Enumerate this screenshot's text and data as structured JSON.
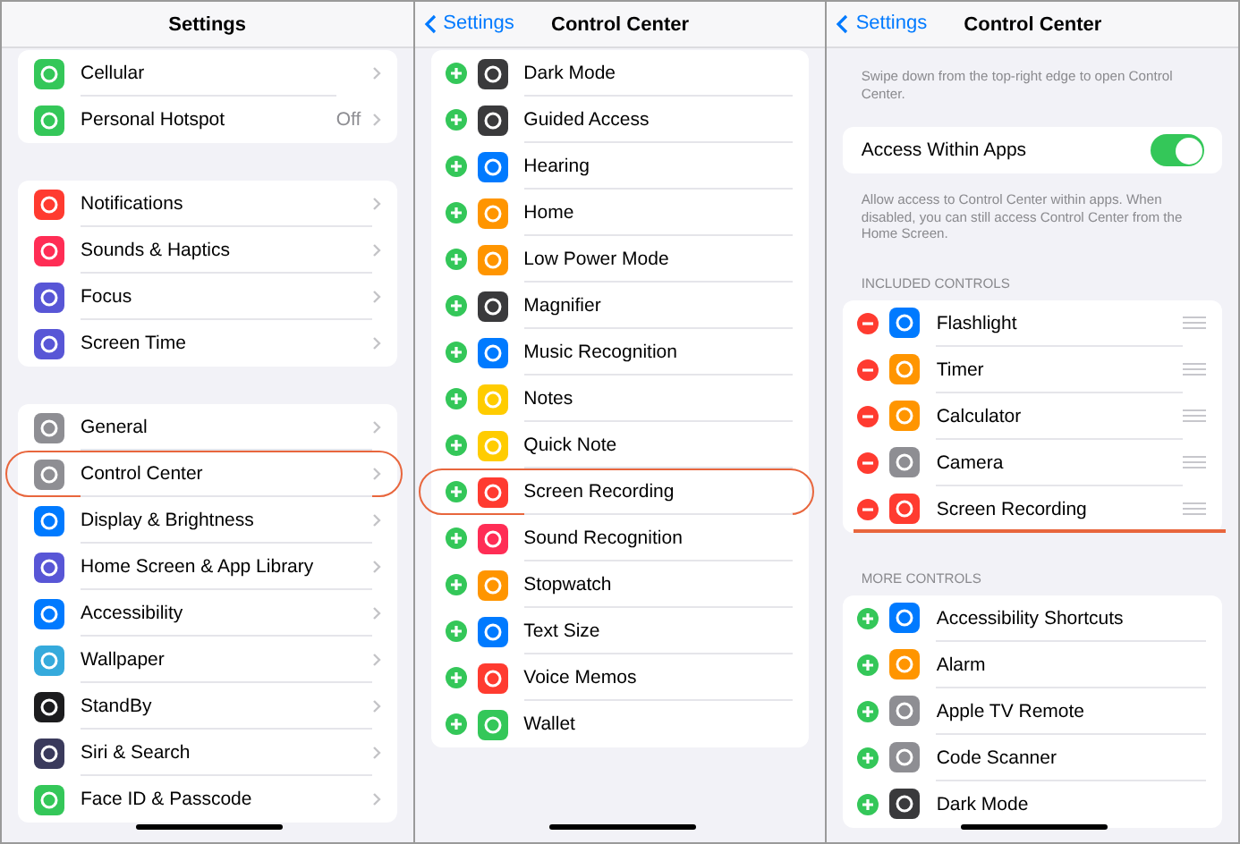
{
  "panels": [
    {
      "header": {
        "title": "Settings"
      },
      "sections": [
        {
          "kind": "group",
          "chevrons": true,
          "rows": [
            {
              "label": "Cellular",
              "color": "#34c759"
            },
            {
              "label": "Personal Hotspot",
              "value": "Off",
              "color": "#34c759"
            }
          ]
        },
        {
          "kind": "group",
          "chevrons": true,
          "rows": [
            {
              "label": "Notifications",
              "color": "#ff3b30"
            },
            {
              "label": "Sounds & Haptics",
              "color": "#ff2d55"
            },
            {
              "label": "Focus",
              "color": "#5856d6"
            },
            {
              "label": "Screen Time",
              "color": "#5856d6"
            }
          ]
        },
        {
          "kind": "group",
          "chevrons": true,
          "rows": [
            {
              "label": "General",
              "color": "#8e8e93",
              "outlined": false
            },
            {
              "label": "Control Center",
              "color": "#8e8e93",
              "outlined": true
            },
            {
              "label": "Display & Brightness",
              "color": "#007aff",
              "outlined": false
            },
            {
              "label": "Home Screen & App Library",
              "color": "#5856d6",
              "outlined": false
            },
            {
              "label": "Accessibility",
              "color": "#007aff",
              "outlined": false
            },
            {
              "label": "Wallpaper",
              "color": "#35aadc",
              "outlined": false
            },
            {
              "label": "StandBy",
              "color": "#1c1c1e",
              "outlined": false
            },
            {
              "label": "Siri & Search",
              "color": "#3a3a5c",
              "outlined": false
            },
            {
              "label": "Face ID & Passcode",
              "color": "#34c759",
              "outlined": false
            }
          ]
        }
      ]
    },
    {
      "header": {
        "back": "Settings",
        "title": "Control Center"
      },
      "sections": [
        {
          "kind": "group",
          "add": true,
          "rows": [
            {
              "label": "Dark Mode",
              "color": "#3a3a3c",
              "outlined": false
            },
            {
              "label": "Guided Access",
              "color": "#3a3a3c",
              "outlined": false
            },
            {
              "label": "Hearing",
              "color": "#007aff",
              "outlined": false
            },
            {
              "label": "Home",
              "color": "#ff9500",
              "outlined": false
            },
            {
              "label": "Low Power Mode",
              "color": "#ff9500",
              "outlined": false
            },
            {
              "label": "Magnifier",
              "color": "#3a3a3c",
              "outlined": false
            },
            {
              "label": "Music Recognition",
              "color": "#007aff",
              "outlined": false
            },
            {
              "label": "Notes",
              "color": "#ffcc00",
              "outlined": false
            },
            {
              "label": "Quick Note",
              "color": "#ffcc00",
              "outlined": false
            },
            {
              "label": "Screen Recording",
              "color": "#ff3b30",
              "outlined": true
            },
            {
              "label": "Sound Recognition",
              "color": "#ff2d55",
              "outlined": false
            },
            {
              "label": "Stopwatch",
              "color": "#ff9500",
              "outlined": false
            },
            {
              "label": "Text Size",
              "color": "#007aff",
              "outlined": false
            },
            {
              "label": "Voice Memos",
              "color": "#ff3b30",
              "outlined": false
            },
            {
              "label": "Wallet",
              "color": "#34c759",
              "outlined": false
            }
          ]
        }
      ]
    },
    {
      "header": {
        "back": "Settings",
        "title": "Control Center"
      },
      "sections": [
        {
          "kind": "note",
          "text": "Swipe down from the top-right edge to open Control Center."
        },
        {
          "kind": "toggle",
          "label": "Access Within Apps",
          "on": true
        },
        {
          "kind": "note",
          "text": "Allow access to Control Center within apps. When disabled, you can still access Control Center from the Home Screen."
        },
        {
          "kind": "heading",
          "text": "INCLUDED CONTROLS"
        },
        {
          "kind": "group",
          "remove": true,
          "reorder": true,
          "rows": [
            {
              "label": "Flashlight",
              "color": "#007aff",
              "underlined": false
            },
            {
              "label": "Timer",
              "color": "#ff9500",
              "underlined": false
            },
            {
              "label": "Calculator",
              "color": "#ff9500",
              "underlined": false
            },
            {
              "label": "Camera",
              "color": "#8e8e93",
              "underlined": false
            },
            {
              "label": "Screen Recording",
              "color": "#ff3b30",
              "underlined": true
            }
          ]
        },
        {
          "kind": "heading",
          "text": "MORE CONTROLS"
        },
        {
          "kind": "group",
          "add": true,
          "rows": [
            {
              "label": "Accessibility Shortcuts",
              "color": "#007aff"
            },
            {
              "label": "Alarm",
              "color": "#ff9500"
            },
            {
              "label": "Apple TV Remote",
              "color": "#8e8e93"
            },
            {
              "label": "Code Scanner",
              "color": "#8e8e93"
            },
            {
              "label": "Dark Mode",
              "color": "#3a3a3c"
            }
          ]
        }
      ]
    }
  ]
}
